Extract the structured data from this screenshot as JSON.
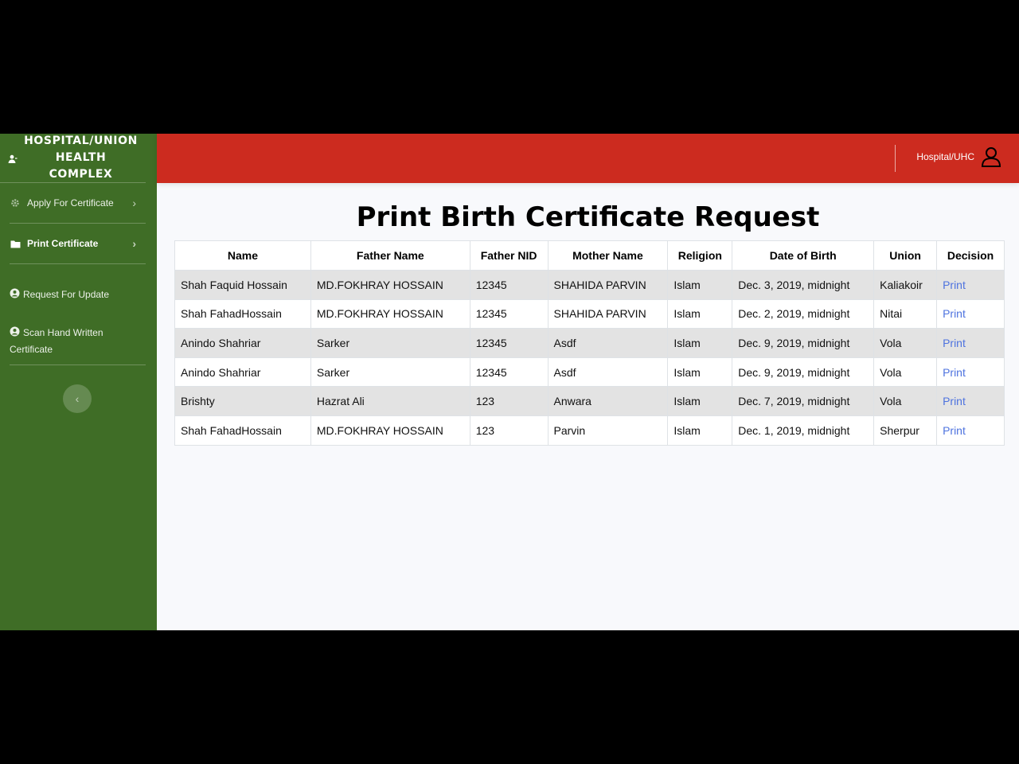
{
  "sidebar": {
    "brand": "HOSPITAL/UNION HEALTH COMPLEX",
    "items": [
      {
        "label": "Apply For Certificate",
        "icon": "gear-icon"
      },
      {
        "label": "Print Certificate",
        "icon": "folder-icon"
      },
      {
        "label": "Request For Update",
        "icon": "user-circle-icon"
      },
      {
        "label": "Scan Hand Written Certificate",
        "icon": "user-circle-icon"
      }
    ],
    "toggle_icon": "chevron-left-icon"
  },
  "topbar": {
    "user_label": "Hospital/UHC",
    "user_icon": "user-outline-icon",
    "color": "#cc2b1f"
  },
  "page": {
    "title": "Print Birth Certificate Request"
  },
  "table": {
    "headers": [
      "Name",
      "Father Name",
      "Father NID",
      "Mother Name",
      "Religion",
      "Date of Birth",
      "Union",
      "Decision"
    ],
    "rows": [
      [
        "Shah Faquid Hossain",
        "MD.FOKHRAY HOSSAIN",
        "12345",
        "SHAHIDA PARVIN",
        "Islam",
        "Dec. 3, 2019, midnight",
        "Kaliakoir",
        "Print"
      ],
      [
        "Shah FahadHossain",
        "MD.FOKHRAY HOSSAIN",
        "12345",
        "SHAHIDA PARVIN",
        "Islam",
        "Dec. 2, 2019, midnight",
        "Nitai",
        "Print"
      ],
      [
        "Anindo Shahriar",
        "Sarker",
        "12345",
        "Asdf",
        "Islam",
        "Dec. 9, 2019, midnight",
        "Vola",
        "Print"
      ],
      [
        "Anindo Shahriar",
        "Sarker",
        "12345",
        "Asdf",
        "Islam",
        "Dec. 9, 2019, midnight",
        "Vola",
        "Print"
      ],
      [
        "Brishty",
        "Hazrat Ali",
        "123",
        "Anwara",
        "Islam",
        "Dec. 7, 2019, midnight",
        "Vola",
        "Print"
      ],
      [
        "Shah FahadHossain",
        "MD.FOKHRAY HOSSAIN",
        "123",
        "Parvin",
        "Islam",
        "Dec. 1, 2019, midnight",
        "Sherpur",
        "Print"
      ]
    ]
  },
  "colors": {
    "sidebar": "#3f6d26",
    "link": "#4e73df"
  }
}
